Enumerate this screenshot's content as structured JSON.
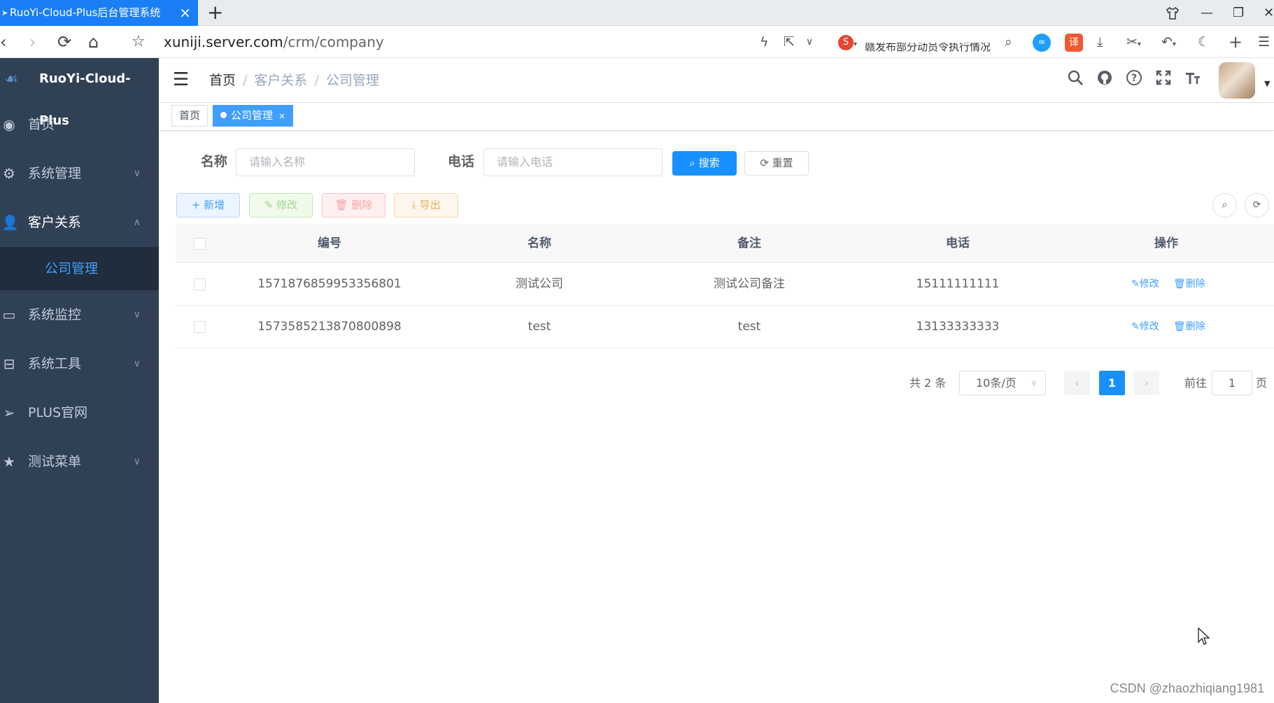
{
  "browser": {
    "tab_title": "RuoYi-Cloud-Plus后台管理系统",
    "tab_close": "×",
    "new_tab": "+",
    "url_host": "xuniji.server.com",
    "url_path": "/crm/company",
    "cut_text": "赣发布部分动员令执行情况",
    "ext_translate": "译",
    "ext_s": "S"
  },
  "sidebar": {
    "logo_title": "RuoYi-Cloud-Plus",
    "items": [
      {
        "label": "首页"
      },
      {
        "label": "系统管理"
      },
      {
        "label": "客户关系"
      },
      {
        "label": "公司管理"
      },
      {
        "label": "系统监控"
      },
      {
        "label": "系统工具"
      },
      {
        "label": "PLUS官网"
      },
      {
        "label": "测试菜单"
      }
    ]
  },
  "header": {
    "breadcrumb": [
      "首页",
      "客户关系",
      "公司管理"
    ],
    "breadcrumb_sep": "/"
  },
  "tags": {
    "items": [
      {
        "label": "首页"
      },
      {
        "label": "公司管理"
      }
    ],
    "close": "×"
  },
  "search": {
    "name_label": "名称",
    "name_placeholder": "请输入名称",
    "phone_label": "电话",
    "phone_placeholder": "请输入电话",
    "search_btn": "搜索",
    "reset_btn": "重置"
  },
  "toolbar": {
    "add": "新增",
    "edit": "修改",
    "delete": "删除",
    "export": "导出"
  },
  "table": {
    "headers": [
      "编号",
      "名称",
      "备注",
      "电话",
      "操作"
    ],
    "rows": [
      {
        "id": "1571876859953356801",
        "name": "测试公司",
        "remark": "测试公司备注",
        "phone": "15111111111",
        "edit": "修改",
        "delete": "删除"
      },
      {
        "id": "1573585213870800898",
        "name": "test",
        "remark": "test",
        "phone": "13133333333",
        "edit": "修改",
        "delete": "删除"
      }
    ]
  },
  "pagination": {
    "total": "共 2 条",
    "page_size": "10条/页",
    "current": "1",
    "goto_label": "前往",
    "goto_value": "1",
    "page_suffix": "页"
  },
  "watermark": "CSDN @zhaozhiqiang1981",
  "colors": {
    "sidebar_bg": "#304156",
    "sidebar_active_bg": "#1f2d3d",
    "primary": "#1890ff",
    "menu_text": "#bfcbd9",
    "active_text": "#409eff"
  }
}
